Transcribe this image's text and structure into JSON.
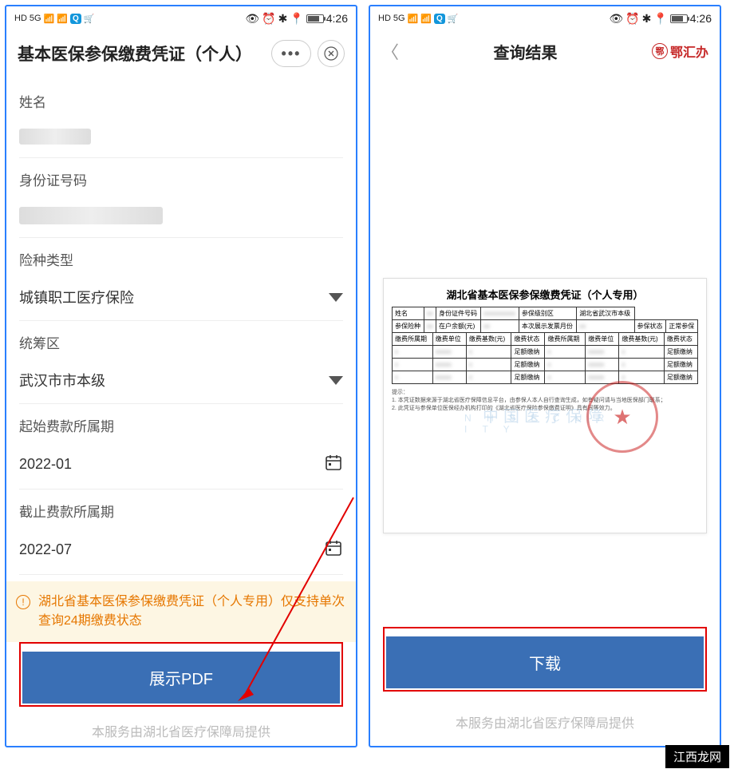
{
  "status": {
    "time": "4:26"
  },
  "left": {
    "title": "基本医保参保缴费凭证（个人）",
    "fields": {
      "name_label": "姓名",
      "id_label": "身份证号码",
      "type_label": "险种类型",
      "type_value": "城镇职工医疗保险",
      "region_label": "统筹区",
      "region_value": "武汉市市本级",
      "start_label": "起始费款所属期",
      "start_value": "2022-01",
      "end_label": "截止费款所属期",
      "end_value": "2022-07"
    },
    "notice": "湖北省基本医保参保缴费凭证（个人专用）仅支持单次查询24期缴费状态",
    "button": "展示PDF",
    "footer": "本服务由湖北省医疗保障局提供"
  },
  "right": {
    "title": "查询结果",
    "brand": "鄂汇办",
    "doc_title": "湖北省基本医保参保缴费凭证（个人专用）",
    "table": {
      "r1": [
        "姓名",
        "",
        "身份证件号码",
        "",
        "参保级别区",
        "湖北省武汉市本级"
      ],
      "r2": [
        "参保险种",
        "",
        "在户余额(元)",
        "",
        "本次展示发票月份",
        "",
        "参保状态",
        "正常参保"
      ],
      "r3a": "缴费所属期",
      "r3b": "缴费单位",
      "r3c": "缴费基数(元)",
      "r3d": "缴费状态",
      "r3e": "缴费所属期",
      "r3f": "缴费单位",
      "r3g": "缴费基数(元)",
      "r3h": "缴费状态",
      "paid": "足额缴纳"
    },
    "notes_head": "提示：",
    "note1": "1. 本凭证数据来源于湖北省医疗保障信息平台，由参保人本人自行查询生成，如有疑问请与当地医保部门联系；",
    "note2": "2. 此凭证与参保单位医保经办机构打印的《湖北省医疗保险参保缴费证明》具有同等效力。",
    "button": "下载",
    "footer": "本服务由湖北省医疗保障局提供"
  },
  "watermark": "江西龙网"
}
